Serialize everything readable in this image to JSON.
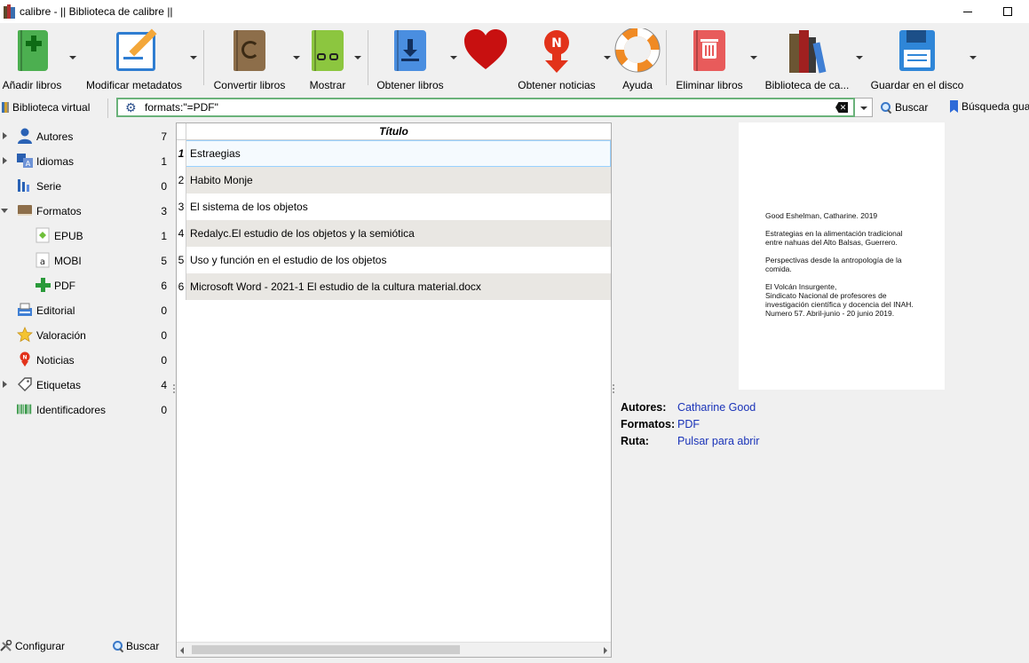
{
  "window": {
    "title": "calibre - || Biblioteca de calibre ||"
  },
  "toolbar": {
    "add_books": "Añadir libros",
    "edit_metadata": "Modificar metadatos",
    "convert_books": "Convertir libros",
    "view": "Mostrar",
    "get_books": "Obtener libros",
    "fetch_news": "Obtener noticias",
    "help": "Ayuda",
    "remove_books": "Eliminar libros",
    "library": "Biblioteca de ca...",
    "save_to_disk": "Guardar en el disco"
  },
  "search": {
    "virtual_library": "Biblioteca virtual",
    "query": "formats:\"=PDF\"",
    "find_label": "Buscar",
    "saved_searches": "Búsqueda gua"
  },
  "tag_browser": {
    "items": [
      {
        "name": "Autores",
        "count": "7"
      },
      {
        "name": "Idiomas",
        "count": "1"
      },
      {
        "name": "Serie",
        "count": "0"
      },
      {
        "name": "Formatos",
        "count": "3"
      },
      {
        "name": "EPUB",
        "count": "1"
      },
      {
        "name": "MOBI",
        "count": "5"
      },
      {
        "name": "PDF",
        "count": "6"
      },
      {
        "name": "Editorial",
        "count": "0"
      },
      {
        "name": "Valoración",
        "count": "0"
      },
      {
        "name": "Noticias",
        "count": "0"
      },
      {
        "name": "Etiquetas",
        "count": "4"
      },
      {
        "name": "Identificadores",
        "count": "0"
      }
    ],
    "configure": "Configurar",
    "find": "Buscar"
  },
  "book_list": {
    "column_title": "Título",
    "rows": [
      {
        "num": "1",
        "title": "Estraegias"
      },
      {
        "num": "2",
        "title": "Habito Monje"
      },
      {
        "num": "3",
        "title": "El sistema de los objetos"
      },
      {
        "num": "4",
        "title": "Redalyc.El estudio de los objetos y la semiótica"
      },
      {
        "num": "5",
        "title": "Uso y función en el estudio de los objetos"
      },
      {
        "num": "6",
        "title": "Microsoft Word - 2021-1 El estudio de la cultura material.docx"
      }
    ]
  },
  "cover": {
    "lines": [
      "Good Eshelman, Catharine. 2019",
      "Estrategias en la alimentación tradicional\nentre nahuas del Alto Balsas, Guerrero.",
      "Perspectivas desde la antropología de la\ncomida.",
      "El Volcán Insurgente,\nSindicato Nacional de profesores de\ninvestigación científica y docencia del INAH.\nNumero 57.  Abril-junio - 20 junio 2019."
    ]
  },
  "details": {
    "authors_label": "Autores:",
    "authors_value": "Catharine Good",
    "formats_label": "Formatos:",
    "formats_value": "PDF",
    "path_label": "Ruta:",
    "path_value": "Pulsar para abrir"
  },
  "colors": {
    "link": "#1a33b8",
    "search_border": "#6ab27a",
    "selection": "#99d1ff"
  }
}
